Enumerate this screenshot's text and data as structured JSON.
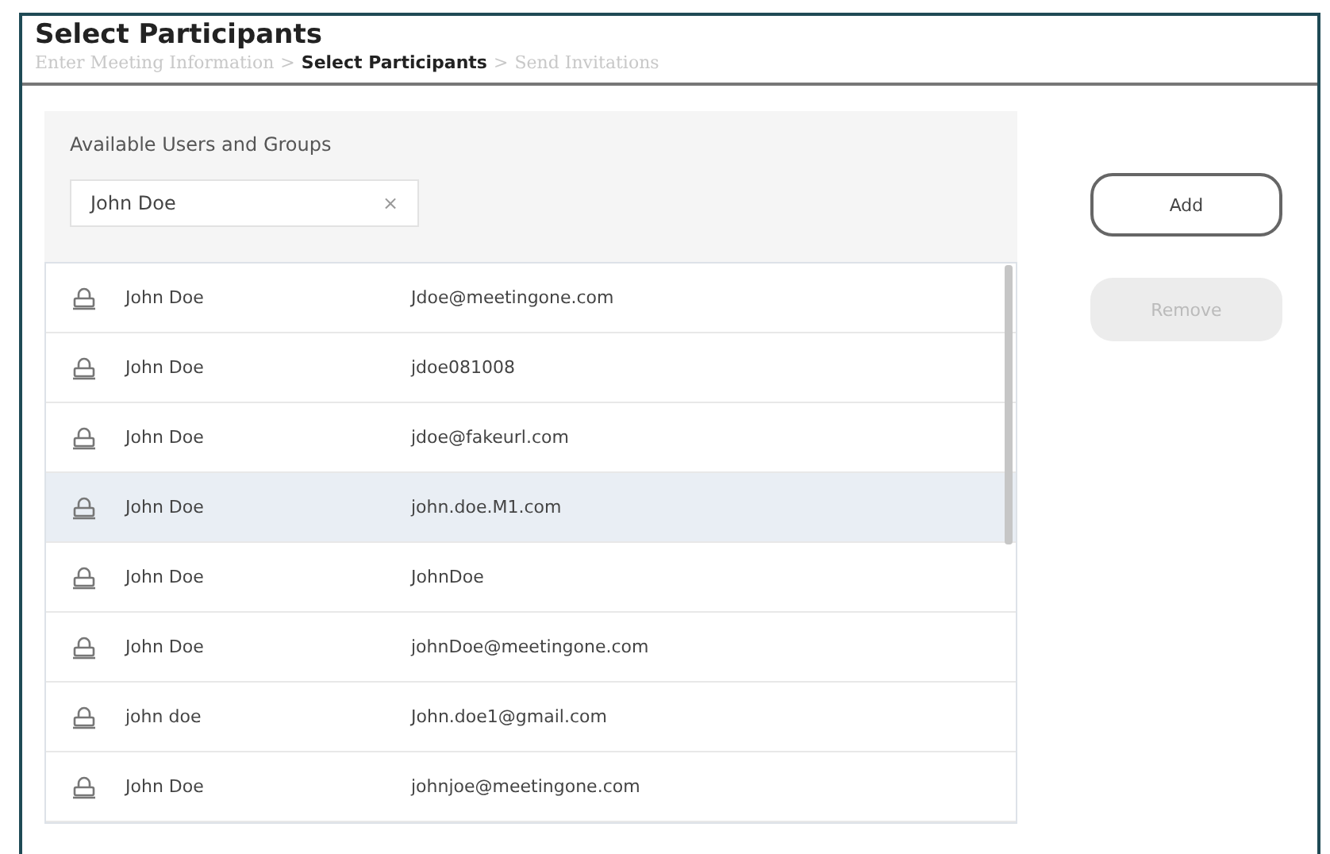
{
  "title": "Select Participants",
  "breadcrumb": [
    {
      "label": "Enter Meeting Information",
      "selected": false
    },
    {
      "label": "Select Participants",
      "selected": true
    },
    {
      "label": "Send Invitations",
      "selected": false
    }
  ],
  "breadcrumb_separator": ">",
  "panel": {
    "heading": "Available Users and Groups",
    "search": {
      "value": "John Doe",
      "clear": "×"
    }
  },
  "rows": [
    {
      "name": "John Doe",
      "login": "Jdoe@meetingone.com",
      "selected": false
    },
    {
      "name": "John Doe",
      "login": "jdoe081008",
      "selected": false
    },
    {
      "name": "John Doe",
      "login": "jdoe@fakeurl.com",
      "selected": false
    },
    {
      "name": "John Doe",
      "login": "john.doe.M1.com",
      "selected": true
    },
    {
      "name": "John Doe",
      "login": "JohnDoe",
      "selected": false
    },
    {
      "name": "John Doe",
      "login": "johnDoe@meetingone.com",
      "selected": false
    },
    {
      "name": "john doe",
      "login": "John.doe1@gmail.com",
      "selected": false
    },
    {
      "name": "John Doe",
      "login": "johnjoe@meetingone.com",
      "selected": false
    }
  ],
  "buttons": [
    {
      "label": "Add",
      "disabled": false
    },
    {
      "label": "Remove",
      "disabled": true
    }
  ]
}
